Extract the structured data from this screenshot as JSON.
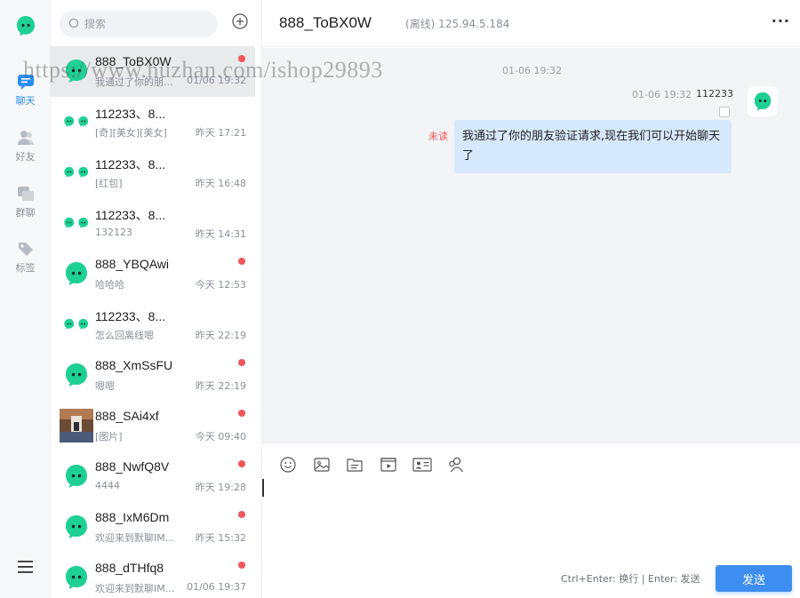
{
  "colors": {
    "brand_green": "#1fd094",
    "accent_blue": "#3d8ef0",
    "unread_red": "#f0555a"
  },
  "nav": {
    "logo": "chat-logo-icon",
    "items": [
      {
        "label": "聊天",
        "icon": "chat-icon",
        "active": true
      },
      {
        "label": "好友",
        "icon": "friends-icon",
        "active": false
      },
      {
        "label": "群聊",
        "icon": "group-icon",
        "active": false
      },
      {
        "label": "标签",
        "icon": "tag-icon",
        "active": false
      }
    ],
    "menu_icon": "hamburger-menu-icon"
  },
  "search": {
    "placeholder": "搜索"
  },
  "conversations": [
    {
      "name": "888_ToBX0W",
      "preview": "我通过了你的朋...",
      "time": "01/06 19:32",
      "unread": true,
      "avatar": "single",
      "active": true
    },
    {
      "name": "112233、8...",
      "preview": "[奇][美女][美女]",
      "time": "昨天 17:21",
      "unread": false,
      "avatar": "group"
    },
    {
      "name": "112233、8...",
      "preview": "[红包]",
      "time": "昨天 16:48",
      "unread": false,
      "avatar": "group"
    },
    {
      "name": "112233、8...",
      "preview": "132123",
      "time": "昨天 14:31",
      "unread": false,
      "avatar": "group"
    },
    {
      "name": "888_YBQAwi",
      "preview": "哈哈哈",
      "time": "今天 12:53",
      "unread": true,
      "avatar": "single"
    },
    {
      "name": "112233、8...",
      "preview": "怎么回离线嗯",
      "time": "昨天 22:19",
      "unread": false,
      "avatar": "group"
    },
    {
      "name": "888_XmSsFU",
      "preview": "嗯嗯",
      "time": "昨天 22:19",
      "unread": true,
      "avatar": "single"
    },
    {
      "name": "888_SAi4xf",
      "preview": "[图片]",
      "time": "今天 09:40",
      "unread": true,
      "avatar": "photo"
    },
    {
      "name": "888_NwfQ8V",
      "preview": "4444",
      "time": "昨天 19:28",
      "unread": true,
      "avatar": "single"
    },
    {
      "name": "888_IxM6Dm",
      "preview": "欢迎来到默聊IM...",
      "time": "昨天 15:32",
      "unread": true,
      "avatar": "single"
    },
    {
      "name": "888_dTHfq8",
      "preview": "欢迎来到默聊IM...",
      "time": "01/06 19:37",
      "unread": true,
      "avatar": "single"
    }
  ],
  "chat": {
    "title": "888_ToBX0W",
    "status": "(离线) 125.94.5.184",
    "more": "···",
    "divider_time": "01-06 19:32",
    "message": {
      "time": "01-06 19:32",
      "sender": "112233",
      "read_status": "未读",
      "text": "我通过了你的朋友验证请求,现在我们可以开始聊天了"
    }
  },
  "composer": {
    "tools": [
      "emoji-icon",
      "image-icon",
      "file-icon",
      "video-icon",
      "contact-card-icon",
      "group-members-icon"
    ],
    "hint": "Ctrl+Enter: 换行 | Enter: 发送",
    "send_label": "发送"
  },
  "watermark": "https://www.huzhan.com/ishop29893"
}
